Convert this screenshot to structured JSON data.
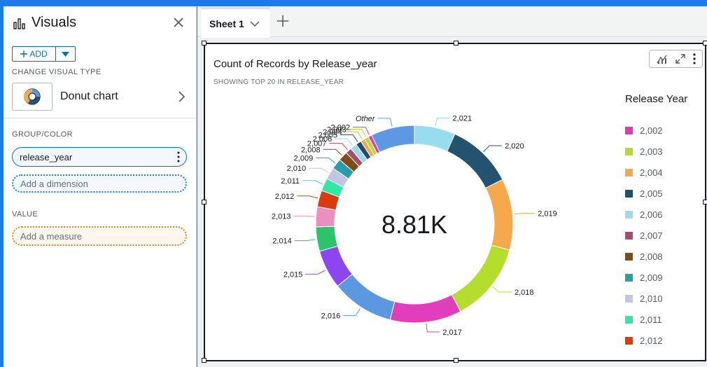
{
  "panel": {
    "title": "Visuals",
    "add_label": "ADD",
    "change_visual_type_label": "CHANGE VISUAL TYPE",
    "visual_type": "Donut chart",
    "group_color_label": "GROUP/COLOR",
    "group_field": "release_year",
    "add_dimension_placeholder": "Add a dimension",
    "value_label": "VALUE",
    "add_measure_placeholder": "Add a measure"
  },
  "sheets": {
    "tabs": [
      {
        "label": "Sheet 1"
      }
    ]
  },
  "visual": {
    "title": "Count of Records by Release_year",
    "subtitle": "SHOWING TOP 20 IN RELEASE_YEAR",
    "center_value": "8.81K",
    "legend_title": "Release Year"
  },
  "chart_data": {
    "type": "pie",
    "donut": true,
    "title": "Count of Records by Release_year",
    "subtitle": "SHOWING TOP 20 IN RELEASE_YEAR",
    "center_label": "8.81K",
    "legend_title": "Release Year",
    "legend_position": "right",
    "slices": [
      {
        "label": "2,021",
        "value": 593,
        "color": "#97dcef"
      },
      {
        "label": "2,020",
        "value": 953,
        "color": "#23536f"
      },
      {
        "label": "2,019",
        "value": 1030,
        "color": "#f6a84d"
      },
      {
        "label": "2,018",
        "value": 1147,
        "color": "#b5dd2d"
      },
      {
        "label": "2,017",
        "value": 1032,
        "color": "#e03ebd"
      },
      {
        "label": "2,016",
        "value": 902,
        "color": "#5b98e0"
      },
      {
        "label": "2,015",
        "value": 560,
        "color": "#8b46f0"
      },
      {
        "label": "2,014",
        "value": 352,
        "color": "#2cc36b"
      },
      {
        "label": "2,013",
        "value": 288,
        "color": "#ea8fc0"
      },
      {
        "label": "2,012",
        "value": 237,
        "color": "#d93a0e"
      },
      {
        "label": "2,011",
        "value": 185,
        "color": "#2ee8a6"
      },
      {
        "label": "2,010",
        "value": 173,
        "color": "#c2c6e2"
      },
      {
        "label": "2,009",
        "value": 152,
        "color": "#2a9ea8"
      },
      {
        "label": "2,008",
        "value": 136,
        "color": "#814d16"
      },
      {
        "label": "2,007",
        "value": 88,
        "color": "#a44e6a"
      },
      {
        "label": "2,006",
        "value": 96,
        "color": "#9fd8ef"
      },
      {
        "label": "2,005",
        "value": 80,
        "color": "#1e4f6d"
      },
      {
        "label": "2,004",
        "value": 64,
        "color": "#f3ab51"
      },
      {
        "label": "2,003",
        "value": 61,
        "color": "#b6da30"
      },
      {
        "label": "2,002",
        "value": 51,
        "color": "#e038b9"
      },
      {
        "label": "Other",
        "value": 630,
        "color": "#5e97e2"
      }
    ],
    "legend": [
      {
        "label": "2,002",
        "color": "#e038b9"
      },
      {
        "label": "2,003",
        "color": "#b6da30"
      },
      {
        "label": "2,004",
        "color": "#f3ab51"
      },
      {
        "label": "2,005",
        "color": "#1e4f6d"
      },
      {
        "label": "2,006",
        "color": "#9fd8ef"
      },
      {
        "label": "2,007",
        "color": "#a44e6a"
      },
      {
        "label": "2,008",
        "color": "#814d16"
      },
      {
        "label": "2,009",
        "color": "#2a9ea8"
      },
      {
        "label": "2,010",
        "color": "#c2c6e2"
      },
      {
        "label": "2,011",
        "color": "#2ee8a6"
      },
      {
        "label": "2,012",
        "color": "#d93a0e"
      }
    ]
  }
}
